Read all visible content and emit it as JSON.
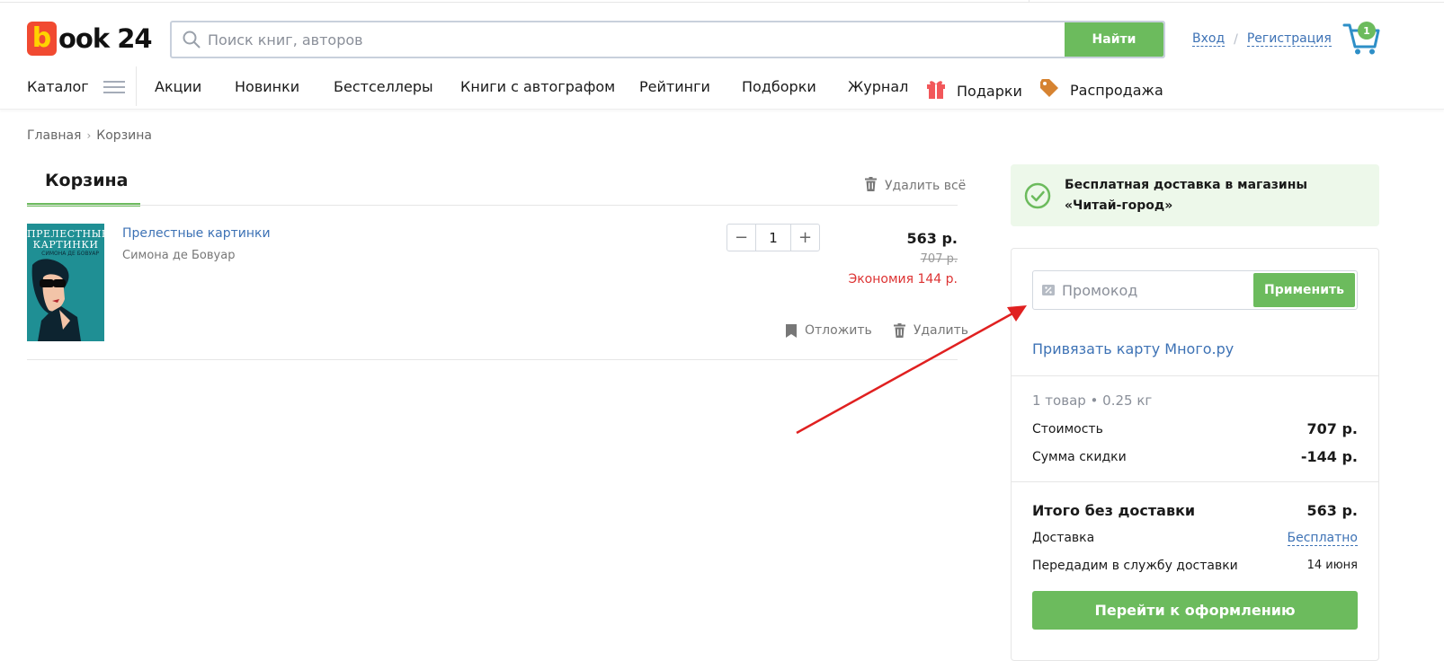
{
  "header": {
    "logo_letter": "b",
    "logo_rest": "ook 24",
    "search_placeholder": "Поиск книг, авторов",
    "search_button": "Найти",
    "login": "Вход",
    "register": "Регистрация",
    "auth_separator": "/",
    "cart_count": "1"
  },
  "nav": {
    "catalog": "Каталог",
    "items": [
      "Акции",
      "Новинки",
      "Бестселлеры",
      "Книги с автографом",
      "Рейтинги",
      "Подборки",
      "Журнал",
      "Подарки",
      "Распродажа"
    ]
  },
  "breadcrumb": {
    "home": "Главная",
    "separator": "›",
    "current": "Корзина"
  },
  "cart": {
    "tab_title": "Корзина",
    "delete_all": "Удалить всё",
    "item": {
      "cover_title": "ПРЕЛЕСТНЫЕ КАРТИНКИ",
      "cover_author": "СИМОНА ДЕ БОВУАР",
      "title": "Прелестные картинки",
      "author": "Симона де Бовуар",
      "qty_minus": "−",
      "qty": "1",
      "qty_plus": "+",
      "price": "563 р.",
      "old_price": "707 р.",
      "economy": "Экономия 144 р.",
      "postpone": "Отложить",
      "delete": "Удалить"
    }
  },
  "sidebar": {
    "free_delivery": "Бесплатная доставка в магазины «Читай-город»",
    "promo_placeholder": "Промокод",
    "apply": "Применить",
    "mnogo_link": "Привязать карту Много.ру",
    "summary": "1 товар • 0.25 кг",
    "cost_label": "Стоимость",
    "cost_value": "707 р.",
    "discount_label": "Сумма скидки",
    "discount_value": "-144 р.",
    "total_label": "Итого без доставки",
    "total_value": "563 р.",
    "delivery_label": "Доставка",
    "delivery_value": "Бесплатно",
    "handover_label": "Передадим в службу доставки",
    "handover_value": "14 июня",
    "checkout": "Перейти к оформлению"
  },
  "colors": {
    "accent_green": "#6cbb5d",
    "link_blue": "#3d72b5",
    "logo_red": "#f14a31",
    "logo_yellow": "#ffd300",
    "economy_red": "#dd3333",
    "annotation_arrow": "#e02020"
  },
  "icons": {
    "search": "search-icon",
    "cart": "cart-icon",
    "burger": "menu-icon",
    "gift": "gift-icon",
    "tag": "tag-icon",
    "trash": "trash-icon",
    "bookmark": "bookmark-icon",
    "check": "check-circle-icon",
    "promo": "percent-ticket-icon"
  }
}
